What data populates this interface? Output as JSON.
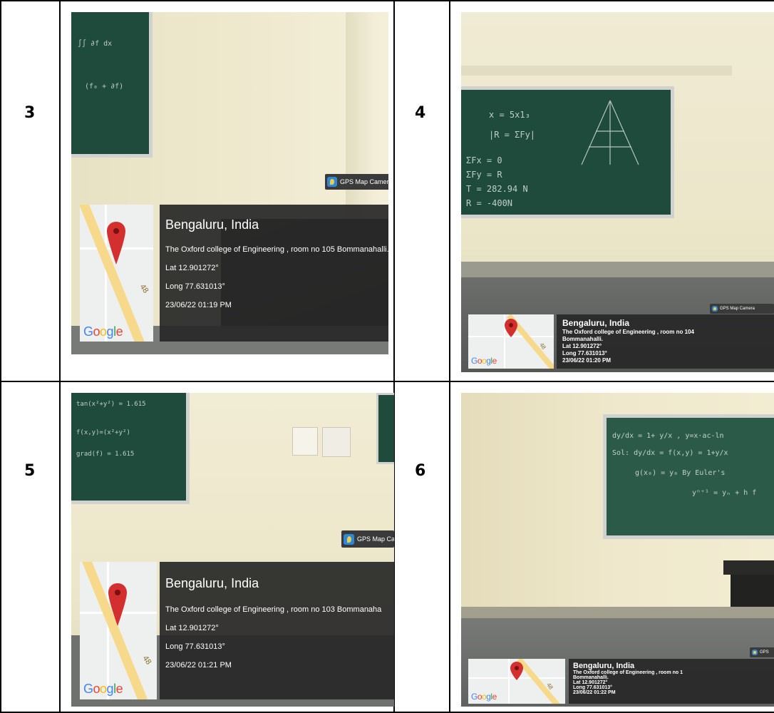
{
  "rows": [
    {
      "cells": [
        {
          "number": "3",
          "photo": {
            "app_label": "GPS Map Camera",
            "location": "Bengaluru, India",
            "address": "The Oxford college of Engineering , room no 105 Bommanahalli.",
            "address_line2": "",
            "lat": "Lat 12.901272°",
            "long": "Long 77.631013°",
            "datetime": "23/06/22 01:19 PM",
            "map_brand": "Google",
            "road_number": "48"
          }
        },
        {
          "number": "4",
          "photo": {
            "app_label": "GPS Map Camera",
            "location": "Bengaluru, India",
            "address": "The Oxford college of Engineering , room no 104",
            "address_line2": "Bommanahalli.",
            "lat": "Lat 12.901272°",
            "long": "Long 77.631013°",
            "datetime": "23/06/22 01:20 PM",
            "map_brand": "Google",
            "road_number": "48"
          }
        }
      ]
    },
    {
      "cells": [
        {
          "number": "5",
          "photo": {
            "app_label": "GPS Map Car",
            "location": "Bengaluru, India",
            "address": "The Oxford college of Engineering , room no 103 Bommanaha",
            "address_line2": "",
            "lat": "Lat 12.901272°",
            "long": "Long 77.631013°",
            "datetime": "23/06/22 01:21 PM",
            "map_brand": "Google",
            "road_number": "48"
          }
        },
        {
          "number": "6",
          "photo": {
            "app_label": "GPS",
            "location": "Bengaluru, India",
            "address": "The Oxford college of Engineering , room no 1",
            "address_line2": "Bommanahalli.",
            "lat": "Lat 12.901272°",
            "long": "Long 77.631013°",
            "datetime": "23/06/22 01:22 PM",
            "map_brand": "Google",
            "road_number": "48"
          }
        }
      ]
    }
  ],
  "colors": {
    "wall": "#ece6c8",
    "chalkboard": "#1f4b3c",
    "panel": "#282828",
    "road": "#f6d98a",
    "pin": "#d32f2f"
  }
}
